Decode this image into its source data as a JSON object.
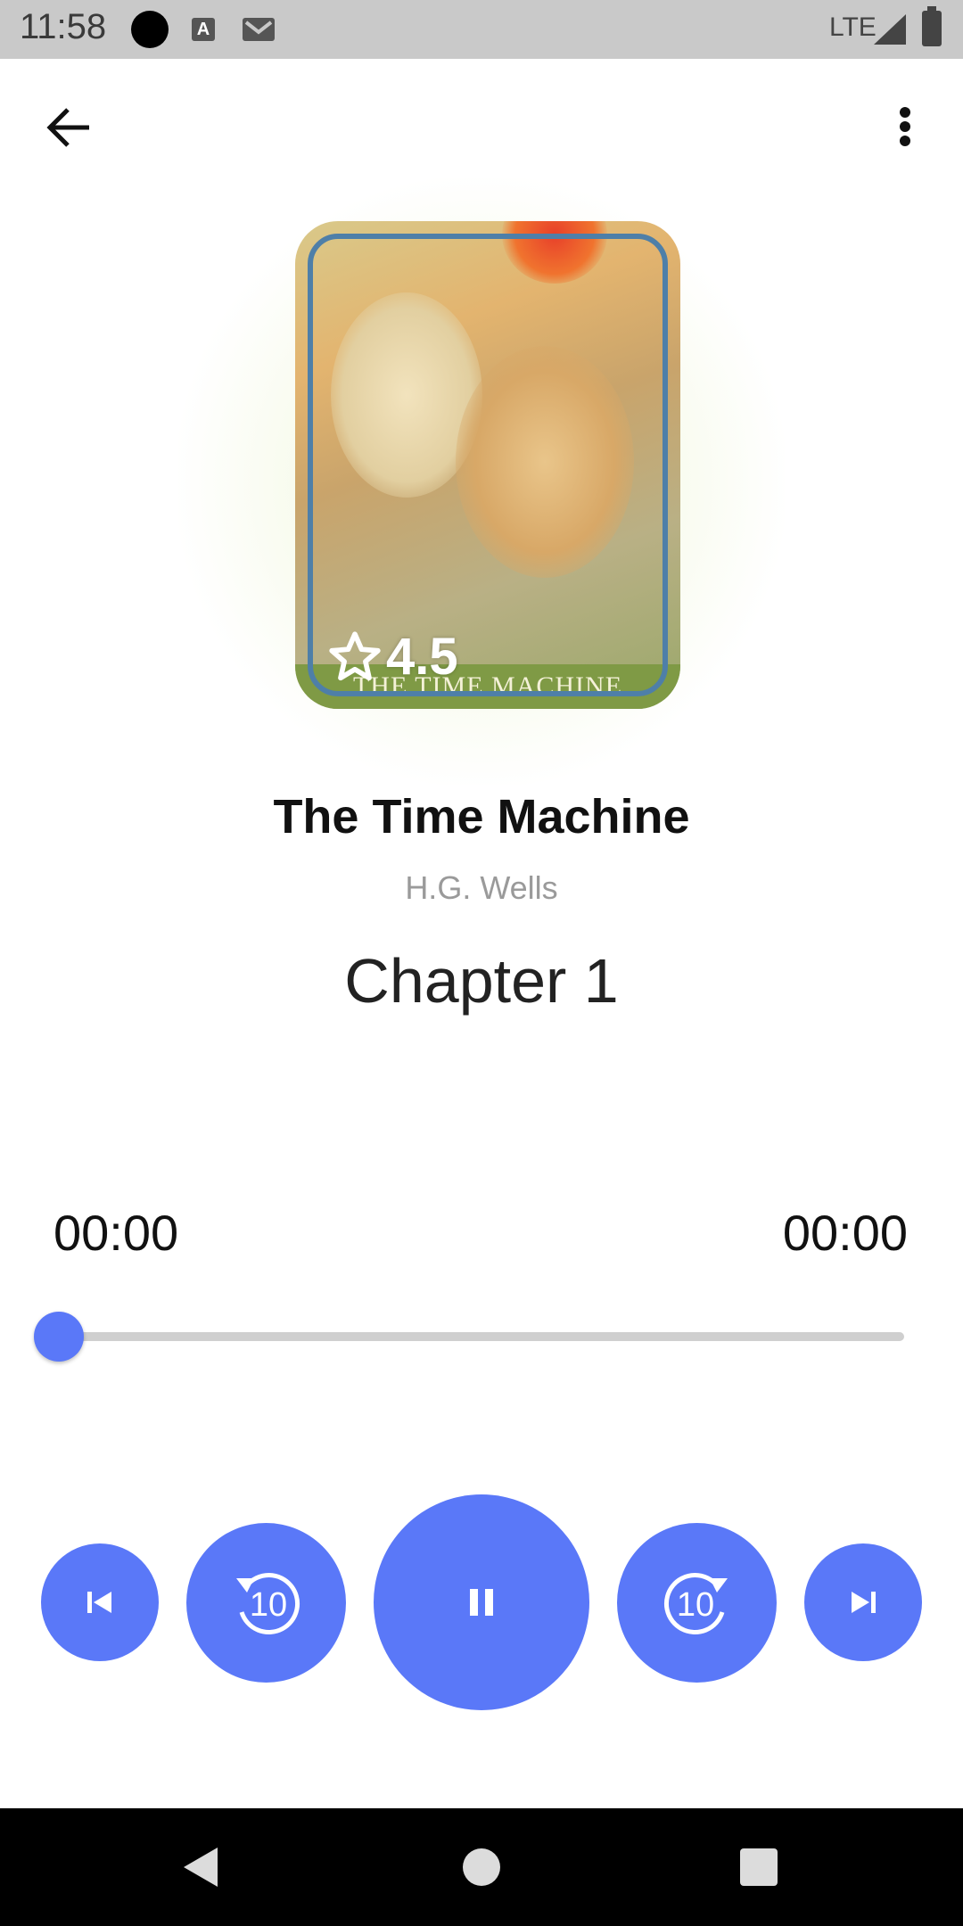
{
  "status_bar": {
    "time": "11:58",
    "network": "LTE",
    "icons": [
      "notification-dot-icon",
      "a-icon",
      "gmail-icon",
      "signal-icon",
      "battery-icon"
    ]
  },
  "app_bar": {
    "back_icon": "arrow-back-icon",
    "menu_icon": "more-vert-icon"
  },
  "book": {
    "cover_title": "THE TIME MACHINE",
    "rating": "4.5",
    "title": "The Time Machine",
    "author": "H.G. Wells",
    "chapter": "Chapter 1"
  },
  "player": {
    "current_time": "00:00",
    "total_time": "00:00",
    "progress": 0,
    "controls": {
      "prev": "skip-previous-icon",
      "rewind": "replay-10-icon",
      "play_pause": "pause-icon",
      "forward": "forward-10-icon",
      "next": "skip-next-icon",
      "seek_seconds": "10"
    }
  },
  "colors": {
    "accent": "#5a78f8",
    "status_bar": "#c9c9c9",
    "nav_bar": "#000000"
  }
}
